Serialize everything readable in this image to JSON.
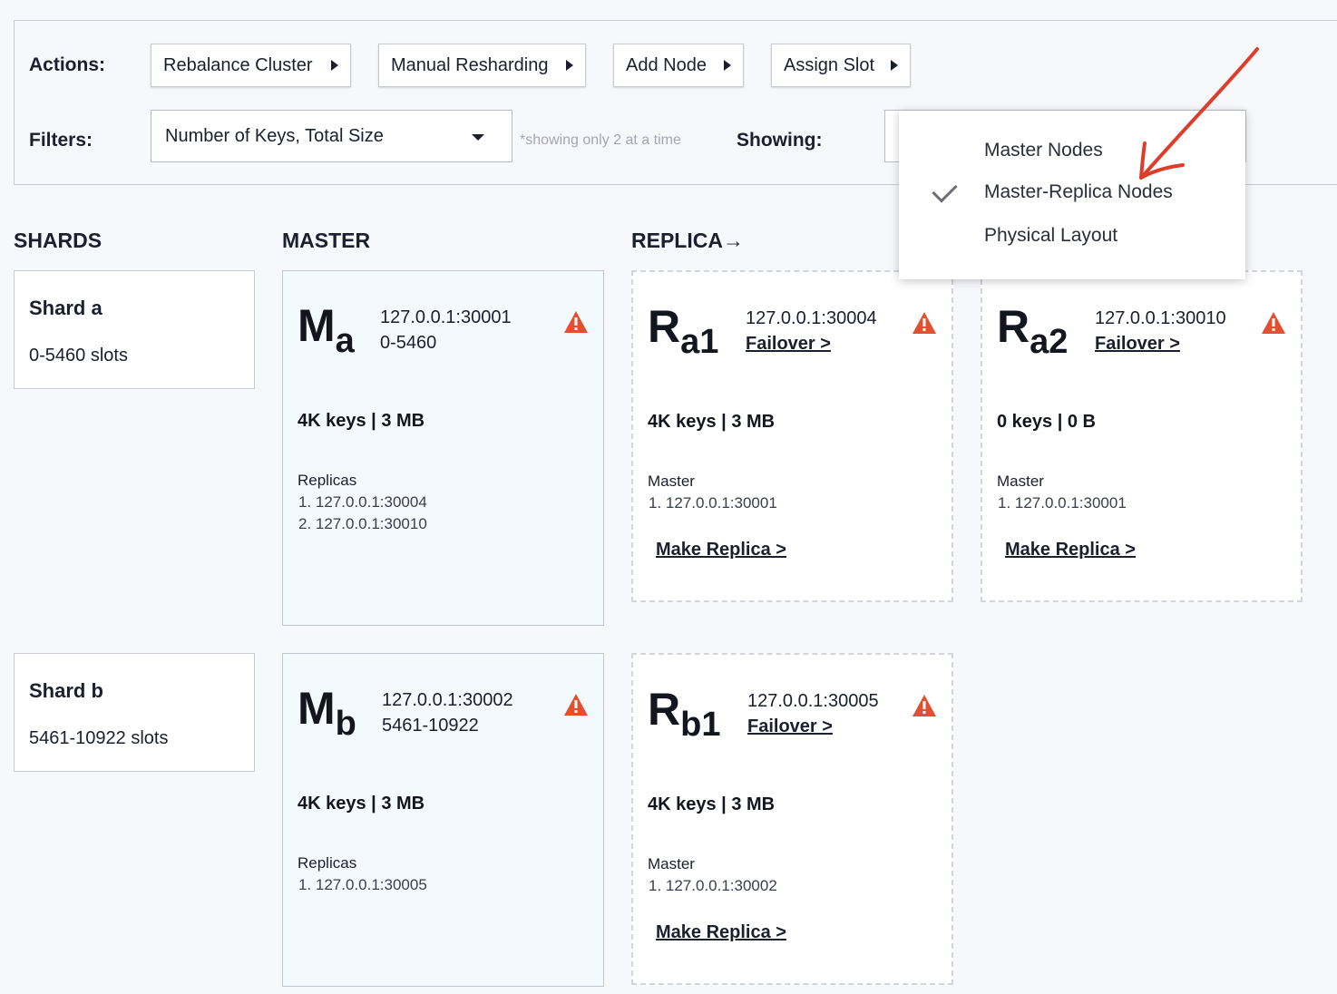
{
  "toolbar": {
    "actions_label": "Actions:",
    "buttons": [
      "Rebalance Cluster",
      "Manual Resharding",
      "Add Node",
      "Assign Slot"
    ],
    "filters_label": "Filters:",
    "filter_value": "Number of Keys, Total Size",
    "filter_note": "*showing only 2 at a time",
    "showing_label": "Showing:"
  },
  "dropdown": {
    "items": [
      "Master Nodes",
      "Master-Replica Nodes",
      "Physical Layout"
    ],
    "selected": "Master-Replica Nodes"
  },
  "columns": {
    "shards": "SHARDS",
    "master": "MASTER",
    "replica": "REPLICA→"
  },
  "shards": [
    {
      "name": "Shard a",
      "slots": "0-5460 slots"
    },
    {
      "name": "Shard b",
      "slots": "5461-10922 slots"
    }
  ],
  "nodes": {
    "ma": {
      "letter": "M",
      "sub": "a",
      "addr": "127.0.0.1:30001",
      "range": "0-5460",
      "stats": "4K keys | 3 MB",
      "list_title": "Replicas",
      "list": [
        "1. 127.0.0.1:30004",
        "2. 127.0.0.1:30010"
      ]
    },
    "ra1": {
      "letter": "R",
      "sub": "a1",
      "addr": "127.0.0.1:30004",
      "failover": "Failover >",
      "stats": "4K keys | 3 MB",
      "list_title": "Master",
      "list": [
        "1. 127.0.0.1:30001"
      ],
      "make_replica": "Make Replica >"
    },
    "ra2": {
      "letter": "R",
      "sub": "a2",
      "addr": "127.0.0.1:30010",
      "failover": "Failover >",
      "stats": "0 keys | 0 B",
      "list_title": "Master",
      "list": [
        "1. 127.0.0.1:30001"
      ],
      "make_replica": "Make Replica >"
    },
    "mb": {
      "letter": "M",
      "sub": "b",
      "addr": "127.0.0.1:30002",
      "range": "5461-10922",
      "stats": "4K keys | 3 MB",
      "list_title": "Replicas",
      "list": [
        "1. 127.0.0.1:30005"
      ]
    },
    "rb1": {
      "letter": "R",
      "sub": "b1",
      "addr": "127.0.0.1:30005",
      "failover": "Failover >",
      "stats": "4K keys | 3 MB",
      "list_title": "Master",
      "list": [
        "1. 127.0.0.1:30002"
      ],
      "make_replica": "Make Replica >"
    }
  },
  "icons": {
    "warning": "warning-triangle-icon",
    "check": "checkmark-icon",
    "annotation": "red-arrow-annotation"
  },
  "colors": {
    "warning": "#e2502f",
    "annotation_arrow": "#e03c2a",
    "master_bg": "#f3fafd"
  }
}
